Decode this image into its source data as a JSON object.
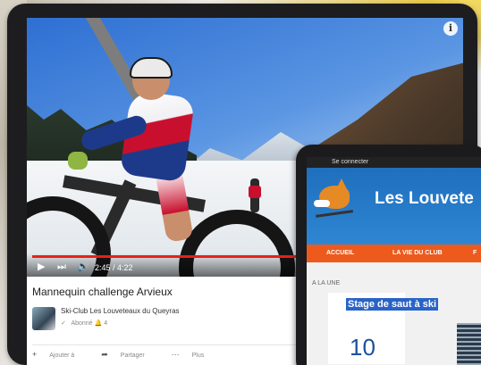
{
  "video": {
    "time": "2:45 / 4:22",
    "progress": 0.63,
    "title": "Mannequin challenge Arvieux",
    "channel": "Ski-Club Les Louveteaux du Queyras",
    "subscribe_label": "Abonné",
    "subscriber_count": "4",
    "actions": {
      "add": "Ajouter à",
      "share": "Partager",
      "more": "Plus"
    }
  },
  "site": {
    "status": "Se connecter",
    "name": "Les Louvete",
    "nav": [
      "ACCUEIL",
      "LA VIE DU CLUB",
      "F"
    ],
    "section": "A LA UNE",
    "headline": "Stage de saut à ski",
    "date_day": "10"
  },
  "colors": {
    "nav_bg": "#ee5a1c",
    "header_bg": "#1f6fbd",
    "progress": "#e62117"
  },
  "icons": [
    "info-icon",
    "play-icon",
    "next-icon",
    "volume-icon",
    "check-icon",
    "bell-icon",
    "plus-icon",
    "share-icon",
    "more-icon",
    "fox-logo"
  ]
}
